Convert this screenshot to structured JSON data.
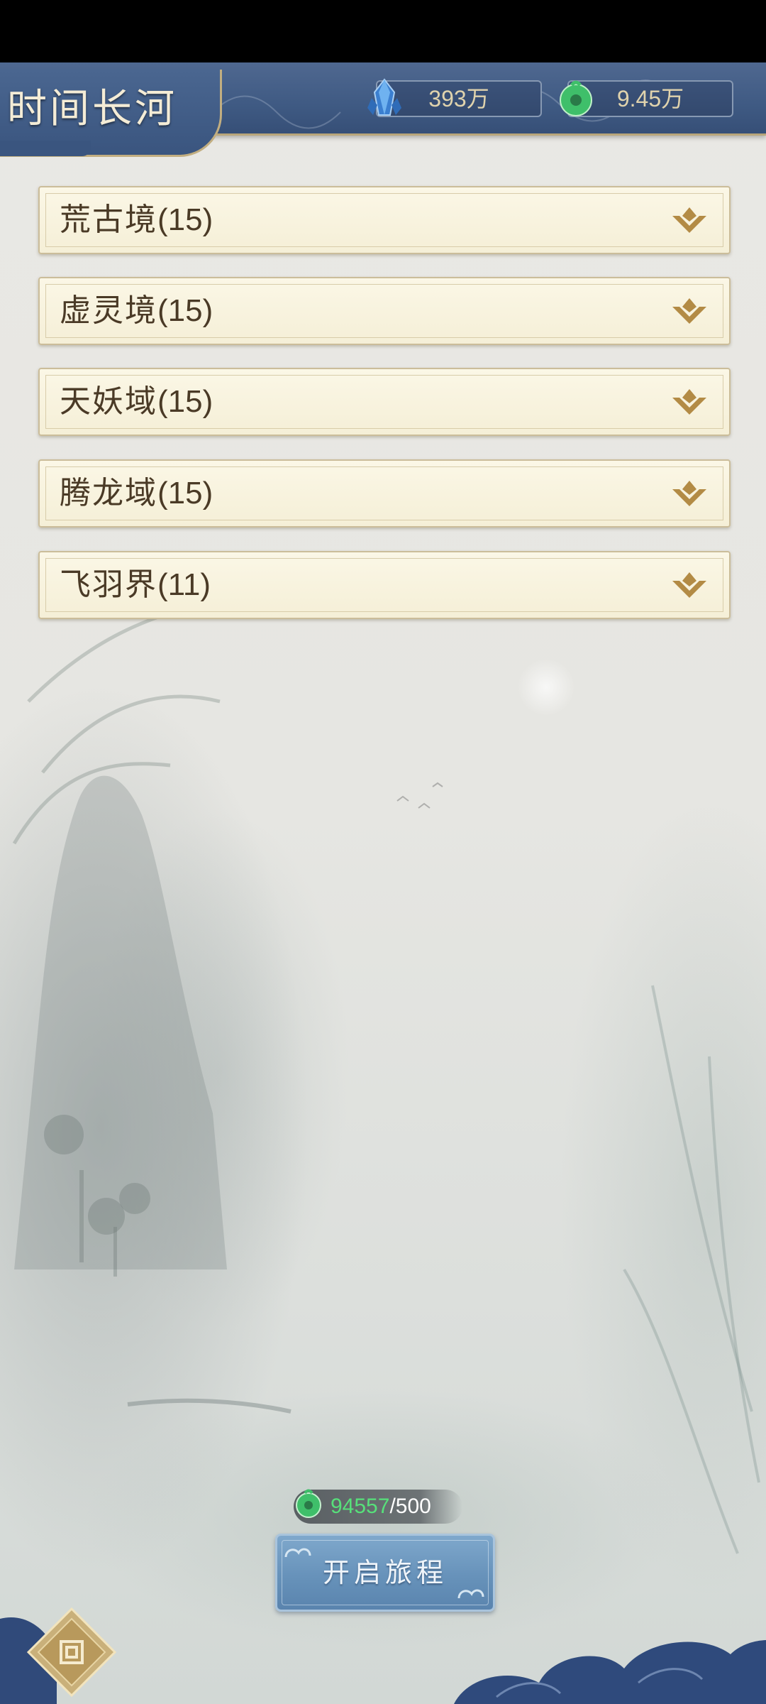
{
  "header": {
    "title": "时间长河",
    "currencies": [
      {
        "icon": "blue-crystal-icon",
        "value": "393万",
        "color": "#4a8ed8"
      },
      {
        "icon": "jade-coin-icon",
        "value": "9.45万",
        "color": "#3fbf6a"
      }
    ]
  },
  "regions": [
    {
      "name": "荒古境",
      "count": "(15)"
    },
    {
      "name": "虚灵境",
      "count": "(15)"
    },
    {
      "name": "天妖域",
      "count": "(15)"
    },
    {
      "name": "腾龙域",
      "count": "(15)"
    },
    {
      "name": "飞羽界",
      "count": "(11)"
    }
  ],
  "cost": {
    "icon": "jade-coin-icon",
    "have": "94557",
    "separator": "/",
    "need": "500",
    "have_color": "#57e07a"
  },
  "start_button": {
    "label": "开启旅程"
  },
  "colors": {
    "header_blue": "#3f5a83",
    "panel_cream": "#f7f1da",
    "gold_trim": "#b38b45",
    "button_blue": "#6792ba"
  }
}
